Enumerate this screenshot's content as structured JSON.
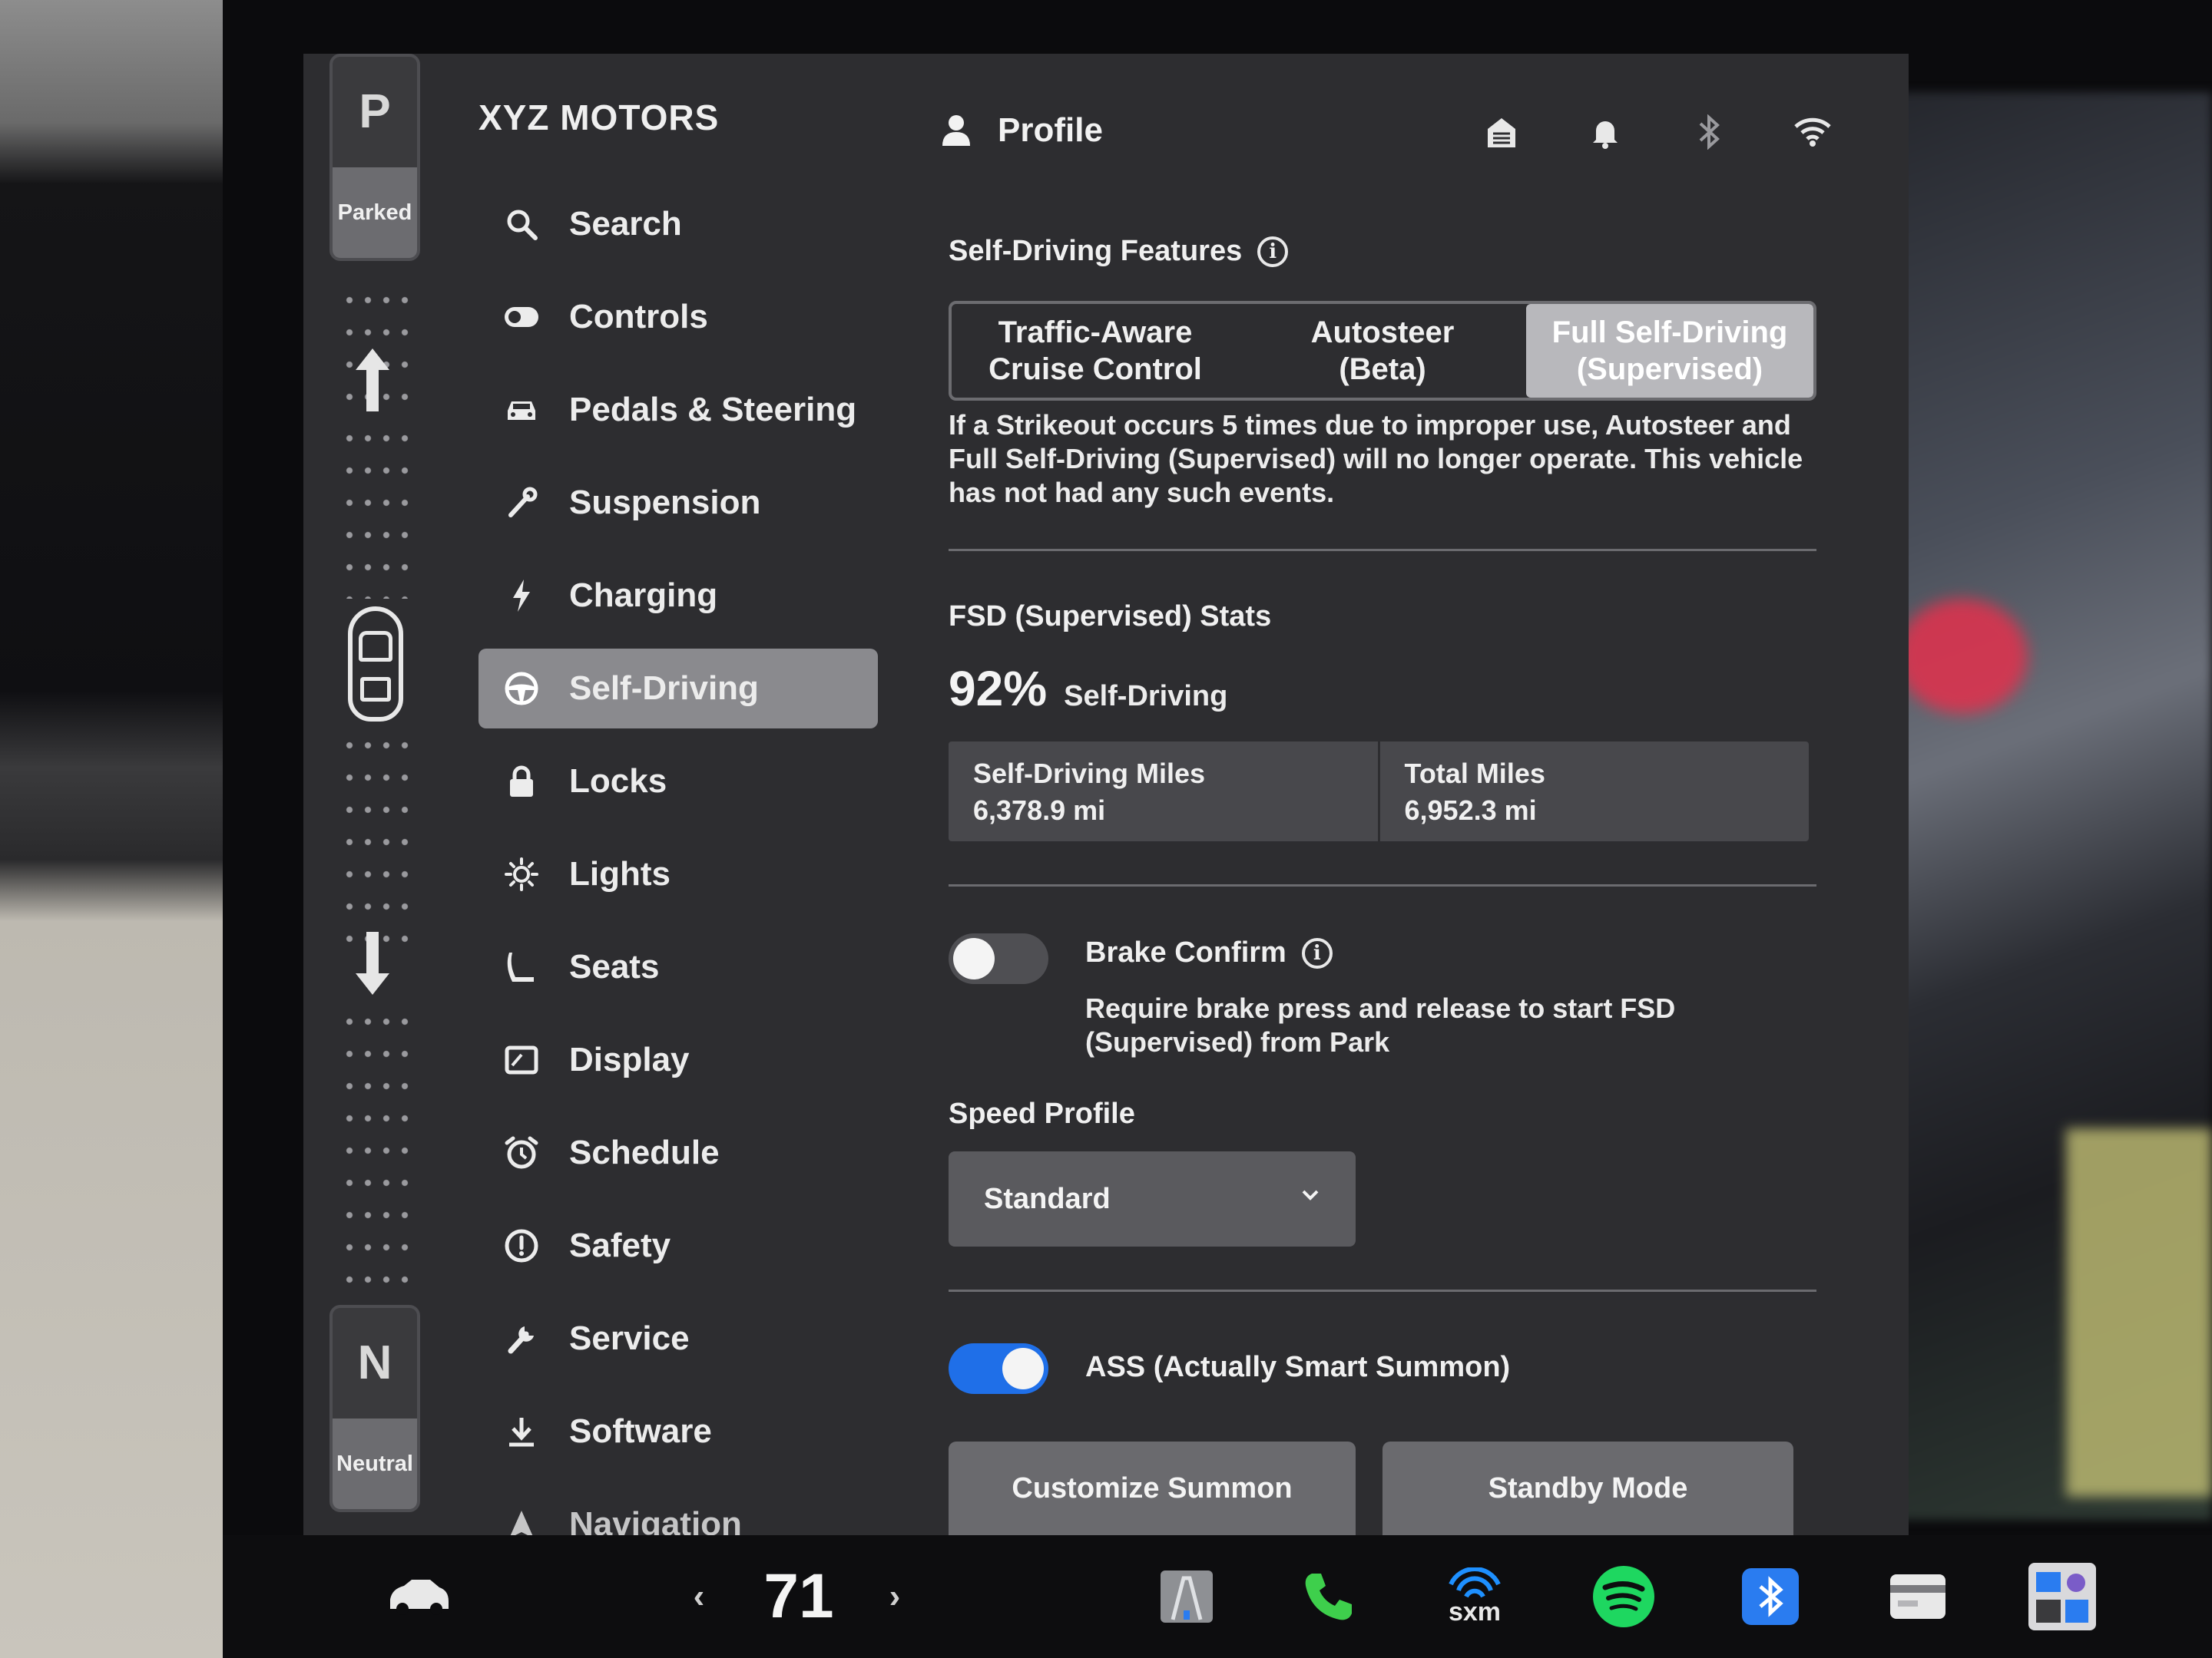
{
  "brand": "XYZ MOTORS",
  "gear": {
    "top_letter": "P",
    "top_state": "Parked",
    "bottom_letter": "N",
    "bottom_state": "Neutral"
  },
  "nav": {
    "items": [
      {
        "label": "Search",
        "icon": "search-icon"
      },
      {
        "label": "Controls",
        "icon": "toggle-icon"
      },
      {
        "label": "Pedals & Steering",
        "icon": "car-icon"
      },
      {
        "label": "Suspension",
        "icon": "wrench-icon"
      },
      {
        "label": "Charging",
        "icon": "lightning-icon"
      },
      {
        "label": "Self-Driving",
        "icon": "steering-wheel-icon",
        "active": true
      },
      {
        "label": "Locks",
        "icon": "lock-icon"
      },
      {
        "label": "Lights",
        "icon": "sun-icon"
      },
      {
        "label": "Seats",
        "icon": "seat-icon"
      },
      {
        "label": "Display",
        "icon": "display-icon"
      },
      {
        "label": "Schedule",
        "icon": "alarm-icon"
      },
      {
        "label": "Safety",
        "icon": "alert-icon"
      },
      {
        "label": "Service",
        "icon": "wrench-icon"
      },
      {
        "label": "Software",
        "icon": "download-icon"
      },
      {
        "label": "Navigation",
        "icon": "navigation-arrow-icon"
      }
    ]
  },
  "header": {
    "profile_label": "Profile",
    "icons": [
      "garage-icon",
      "bell-icon",
      "bluetooth-icon",
      "wifi-icon"
    ]
  },
  "features": {
    "title": "Self-Driving Features",
    "options": [
      "Traffic-Aware\nCruise Control",
      "Autosteer\n(Beta)",
      "Full Self-Driving\n(Supervised)"
    ],
    "selected_index": 2,
    "strikeout_text": "If a Strikeout occurs 5 times due to improper use, Autosteer and Full Self-Driving (Supervised) will no longer operate. This vehicle has not had any such events."
  },
  "stats": {
    "title": "FSD (Supervised) Stats",
    "percent": "92%",
    "percent_label": "Self-Driving",
    "self_driving_miles_label": "Self-Driving Miles",
    "self_driving_miles_value": "6,378.9 mi",
    "total_miles_label": "Total Miles",
    "total_miles_value": "6,952.3 mi"
  },
  "brake_confirm": {
    "label": "Brake Confirm",
    "enabled": false,
    "description": "Require brake press and release to start FSD (Supervised) from Park"
  },
  "speed_profile": {
    "label": "Speed Profile",
    "selected": "Standard"
  },
  "ass": {
    "label": "ASS (Actually Smart Summon)",
    "enabled": true
  },
  "buttons": {
    "customize_summon": "Customize Summon",
    "standby_mode": "Standby Mode"
  },
  "taskbar": {
    "temperature": "71",
    "sxm_label": "sxm",
    "icons": [
      "car-icon",
      "chevron-left-icon",
      "chevron-right-icon",
      "autopilot-icon",
      "phone-icon",
      "siriusxm-icon",
      "spotify-icon",
      "bluetooth-icon",
      "card-icon",
      "dashcam-icon"
    ]
  },
  "colors": {
    "accent_toggle": "#1f6fe8",
    "phone": "#3ecf4c",
    "spotify": "#1ed760",
    "bluetooth_tile": "#2a7cf0",
    "sxm": "#1e90ff"
  }
}
